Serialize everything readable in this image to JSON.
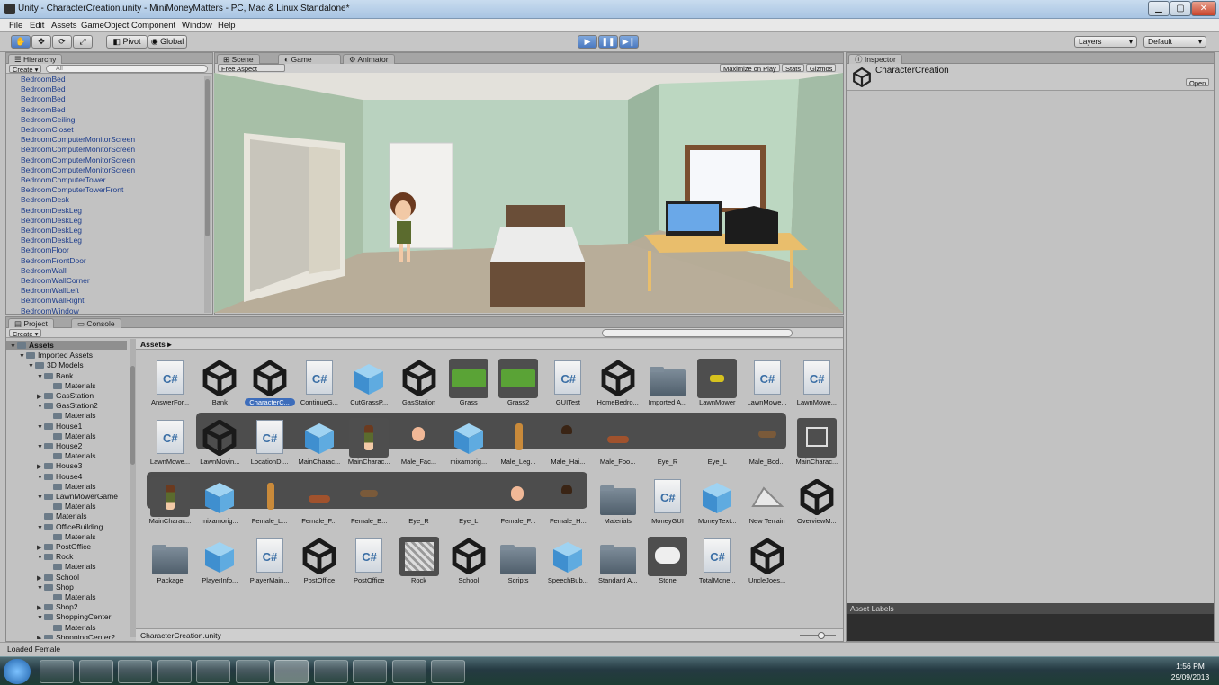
{
  "window": {
    "title": "Unity - CharacterCreation.unity - MiniMoneyMatters - PC, Mac & Linux Standalone*"
  },
  "menu": [
    "File",
    "Edit",
    "Assets",
    "GameObject",
    "Component",
    "Window",
    "Help"
  ],
  "toolbar": {
    "pivot": "Pivot",
    "global": "Global",
    "layers": "Layers",
    "layout": "Default"
  },
  "hierarchy": {
    "tab": "Hierarchy",
    "create": "Create",
    "search_placeholder": "All",
    "items": [
      "BedroomBed",
      "BedroomBed",
      "BedroomBed",
      "BedroomBed",
      "BedroomCeiling",
      "BedroomCloset",
      "BedroomComputerMonitorScreen",
      "BedroomComputerMonitorScreen",
      "BedroomComputerMonitorScreen",
      "BedroomComputerMonitorScreen",
      "BedroomComputerTower",
      "BedroomComputerTowerFront",
      "BedroomDesk",
      "BedroomDeskLeg",
      "BedroomDeskLeg",
      "BedroomDeskLeg",
      "BedroomDeskLeg",
      "BedroomFloor",
      "BedroomFrontDoor",
      "BedroomWall",
      "BedroomWallCorner",
      "BedroomWallLeft",
      "BedroomWallRight",
      "BedroomWindow"
    ]
  },
  "view": {
    "tabs": [
      "Scene",
      "Game",
      "Animator"
    ],
    "aspect": "Free Aspect",
    "maximize": "Maximize on Play",
    "stats": "Stats",
    "gizmos": "Gizmos"
  },
  "inspector": {
    "tab": "Inspector",
    "name": "CharacterCreation",
    "open": "Open",
    "asset_labels": "Asset Labels"
  },
  "project": {
    "tabs": [
      "Project",
      "Console"
    ],
    "create": "Create",
    "breadcrumb": "Assets",
    "footer": "CharacterCreation.unity",
    "tree": [
      {
        "d": 0,
        "t": "Assets",
        "o": true
      },
      {
        "d": 1,
        "t": "Imported Assets",
        "o": true
      },
      {
        "d": 2,
        "t": "3D Models",
        "o": true
      },
      {
        "d": 3,
        "t": "Bank",
        "o": true
      },
      {
        "d": 4,
        "t": "Materials"
      },
      {
        "d": 3,
        "t": "GasStation",
        "o": false
      },
      {
        "d": 3,
        "t": "GasStation2",
        "o": true
      },
      {
        "d": 4,
        "t": "Materials"
      },
      {
        "d": 3,
        "t": "House1",
        "o": true
      },
      {
        "d": 4,
        "t": "Materials"
      },
      {
        "d": 3,
        "t": "House2",
        "o": true
      },
      {
        "d": 4,
        "t": "Materials"
      },
      {
        "d": 3,
        "t": "House3",
        "o": false
      },
      {
        "d": 3,
        "t": "House4",
        "o": true
      },
      {
        "d": 4,
        "t": "Materials"
      },
      {
        "d": 3,
        "t": "LawnMowerGame",
        "o": true
      },
      {
        "d": 4,
        "t": "Materials"
      },
      {
        "d": 3,
        "t": "Materials"
      },
      {
        "d": 3,
        "t": "OfficeBuilding",
        "o": true
      },
      {
        "d": 4,
        "t": "Materials"
      },
      {
        "d": 3,
        "t": "PostOffice",
        "o": false
      },
      {
        "d": 3,
        "t": "Rock",
        "o": true
      },
      {
        "d": 4,
        "t": "Materials"
      },
      {
        "d": 3,
        "t": "School",
        "o": false
      },
      {
        "d": 3,
        "t": "Shop",
        "o": true
      },
      {
        "d": 4,
        "t": "Materials"
      },
      {
        "d": 3,
        "t": "Shop2",
        "o": false
      },
      {
        "d": 3,
        "t": "ShoppingCenter",
        "o": true
      },
      {
        "d": 4,
        "t": "Materials"
      },
      {
        "d": 3,
        "t": "ShoppingCenter2",
        "o": false
      }
    ],
    "row1": [
      [
        "AnswerFor...",
        "cs"
      ],
      [
        "Bank",
        "unity"
      ],
      [
        "CharacterC...",
        "unity"
      ],
      [
        "ContinueG...",
        "cs"
      ],
      [
        "CutGrassP...",
        "cube"
      ],
      [
        "GasStation",
        "unity"
      ],
      [
        "Grass",
        "grass"
      ],
      [
        "Grass2",
        "grass"
      ],
      [
        "GUITest",
        "cs"
      ],
      [
        "HomeBedro...",
        "unity"
      ],
      [
        "Imported A...",
        "folder"
      ],
      [
        "LawnMower",
        "mower"
      ],
      [
        "LawnMowe...",
        "cs"
      ],
      [
        "LawnMowe...",
        "cs"
      ]
    ],
    "row2": [
      [
        "LawnMowe...",
        "cs"
      ],
      [
        "LawnMovin...",
        "unity"
      ],
      [
        "LocationDi...",
        "cs"
      ],
      [
        "MainCharac...",
        "cube"
      ],
      [
        "MainCharac...",
        "girl"
      ],
      [
        "Male_Fac...",
        "face"
      ],
      [
        "mixamorig...",
        "cube"
      ],
      [
        "Male_Leg...",
        "leg"
      ],
      [
        "Male_Hai...",
        "hair"
      ],
      [
        "Male_Foo...",
        "shoe"
      ],
      [
        "Eye_R",
        ""
      ],
      [
        "Eye_L",
        ""
      ],
      [
        "Male_Bod...",
        "body"
      ],
      [
        "MainCharac...",
        "anim"
      ]
    ],
    "row3": [
      [
        "MainCharac...",
        "girl"
      ],
      [
        "mixamorig...",
        "cube"
      ],
      [
        "Female_L...",
        "leg"
      ],
      [
        "Female_F...",
        "shoe"
      ],
      [
        "Female_B...",
        "body"
      ],
      [
        "Eye_R",
        ""
      ],
      [
        "Eye_L",
        ""
      ],
      [
        "Female_F...",
        "face"
      ],
      [
        "Female_H...",
        "hair"
      ],
      [
        "Materials",
        "folder"
      ],
      [
        "MoneyGUI",
        "cs"
      ],
      [
        "MoneyText...",
        "cube"
      ],
      [
        "New Terrain",
        "terrain"
      ],
      [
        "OverviewM...",
        "unity"
      ]
    ],
    "row4": [
      [
        "Package",
        "folder"
      ],
      [
        "PlayerInfo...",
        "cube"
      ],
      [
        "PlayerMain...",
        "cs"
      ],
      [
        "PostOffice",
        "unity"
      ],
      [
        "PostOffice",
        "cs"
      ],
      [
        "Rock",
        "rock"
      ],
      [
        "School",
        "unity"
      ],
      [
        "Scripts",
        "folder"
      ],
      [
        "SpeechBub...",
        "cube"
      ],
      [
        "Standard A...",
        "folder"
      ],
      [
        "Stone",
        "stone"
      ],
      [
        "TotalMone...",
        "cs"
      ],
      [
        "UncleJoes...",
        "unity"
      ]
    ]
  },
  "status": {
    "message": "Loaded Female"
  },
  "taskbar": {
    "time": "1:56 PM",
    "date": "29/09/2013"
  }
}
